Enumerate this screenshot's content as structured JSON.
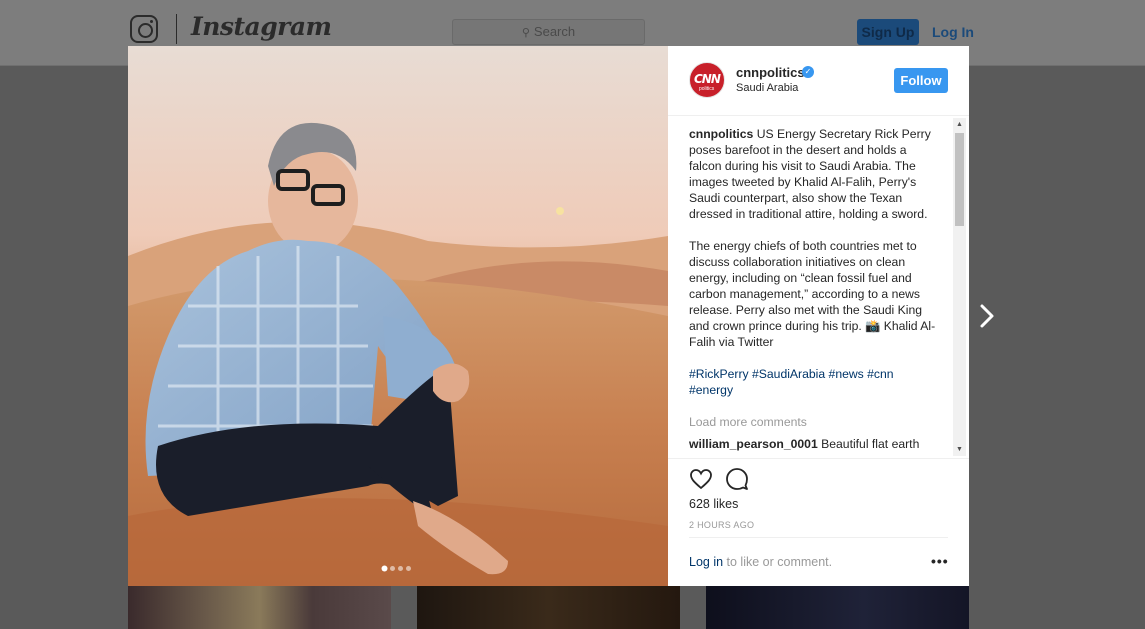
{
  "header": {
    "logo_text": "Instagram",
    "search_placeholder": "Search",
    "signup_label": "Sign Up",
    "login_label": "Log In"
  },
  "post": {
    "username": "cnnpolitics",
    "location": "Saudi Arabia",
    "follow_label": "Follow",
    "avatar_text": "CNN",
    "avatar_subtext": "politics",
    "caption_author": "cnnpolitics",
    "caption_p1": "US Energy Secretary Rick Perry poses barefoot in the desert and holds a falcon during his visit to Saudi Arabia. The images tweeted by Khalid Al-Falih, Perry's Saudi counterpart, also show the Texan dressed in traditional attire, holding a sword.",
    "caption_p2": "The energy chiefs of both countries met to discuss collaboration initiatives on clean energy, including on “clean fossil fuel and carbon management,” according to a news release. Perry also met with the Saudi King and crown prince during his trip. 📸 Khalid Al-Falih via Twitter",
    "hashtags": "#RickPerry #SaudiArabia #news #cnn #energy",
    "load_more": "Load more comments",
    "comment2_author": "william_pearson_0001",
    "comment2_text": "Beautiful flat earth",
    "likes": "628 likes",
    "time": "2 HOURS AGO",
    "login_link": "Log in",
    "login_rest": " to like or comment.",
    "more_label": "•••",
    "carousel": {
      "count": 4,
      "active": 0
    }
  },
  "icons": {
    "heart": "heart-icon",
    "comment": "comment-icon",
    "next": "chevron-right-icon",
    "verified": "verified-badge-icon",
    "search": "search-icon"
  },
  "colors": {
    "accent": "#3897f0",
    "link": "#003569",
    "muted": "#999999"
  }
}
